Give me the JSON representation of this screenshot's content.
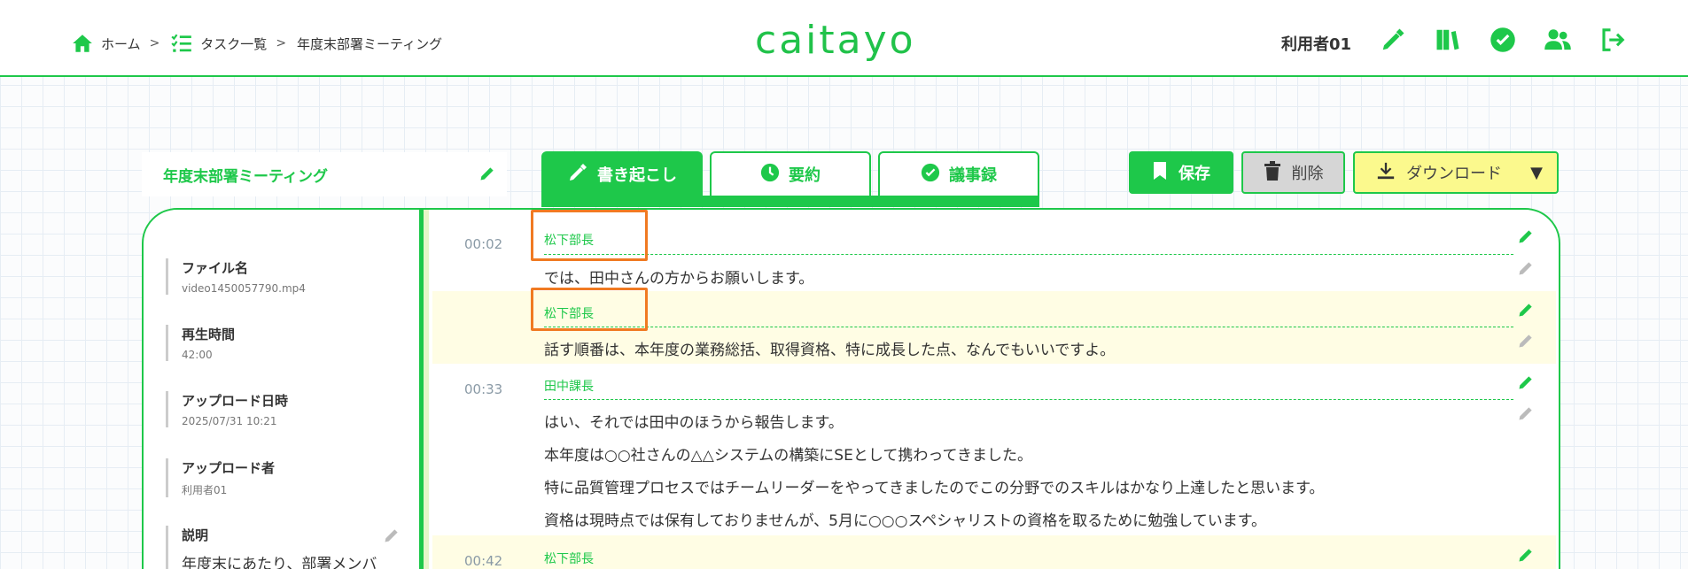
{
  "header": {
    "breadcrumb": [
      {
        "label": "ホーム",
        "icon": "home-icon"
      },
      {
        "label": "タスク一覧",
        "icon": "task-list-icon"
      },
      {
        "label": "年度末部署ミーティング"
      }
    ],
    "logo": "caitayo",
    "user_name": "利用者01",
    "icons": [
      "pen-nib-icon",
      "book-icon",
      "check-circle-icon",
      "users-icon",
      "logout-icon"
    ]
  },
  "document": {
    "title": "年度末部署ミーティング"
  },
  "tabs": [
    {
      "label": "書き起こし",
      "icon": "pen-nib-icon",
      "active": true
    },
    {
      "label": "要約",
      "icon": "clock-icon",
      "active": false
    },
    {
      "label": "議事録",
      "icon": "check-circle-icon",
      "active": false
    }
  ],
  "actions": {
    "save": "保存",
    "delete": "削除",
    "download": "ダウンロード",
    "download_caret": "▼"
  },
  "sidebar": {
    "file_name_label": "ファイル名",
    "file_name": "video1450057790.mp4",
    "duration_label": "再生時間",
    "duration": "42:00",
    "uploaded_at_label": "アップロード日時",
    "uploaded_at": "2025/07/31 10:21",
    "uploader_label": "アップロード者",
    "uploader": "利用者01",
    "description_label": "説明",
    "description": "年度末にあたり、部署メンバ"
  },
  "transcript": [
    {
      "time": "00:02",
      "speaker": "松下部長",
      "lines": [
        "では、田中さんの方からお願いします。"
      ]
    },
    {
      "time": "",
      "speaker": "松下部長",
      "lines": [
        "話す順番は、本年度の業務総括、取得資格、特に成長した点、なんでもいいですよ。"
      ]
    },
    {
      "time": "00:33",
      "speaker": "田中課長",
      "lines": [
        "はい、それでは田中のほうから報告します。",
        "本年度は○○社さんの△△システムの構築にSEとして携わってきました。",
        "特に品質管理プロセスではチームリーダーをやってきましたのでこの分野でのスキルはかなり上達したと思います。",
        "資格は現時点では保有しておりませんが、5月に○○○スペシャリストの資格を取るために勉強しています。"
      ]
    },
    {
      "time": "00:42",
      "speaker": "松下部長",
      "lines": []
    }
  ],
  "colors": {
    "accent": "#1ec84a",
    "highlight_row": "#fffde4",
    "annotation": "#f07a22",
    "download_bg": "#fbf98d"
  }
}
